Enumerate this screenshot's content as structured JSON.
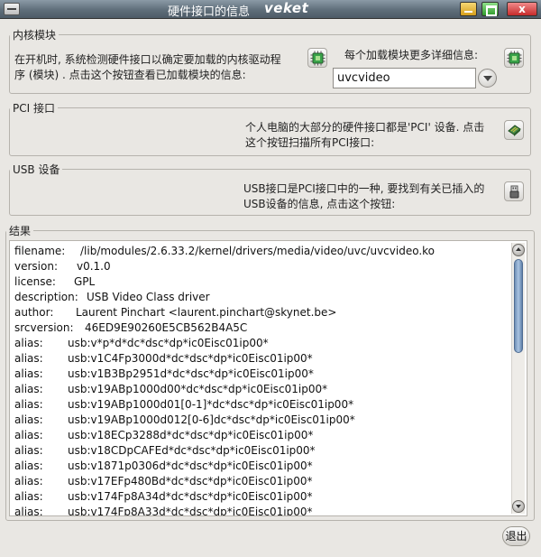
{
  "window": {
    "title": "硬件接口的信息",
    "brand": "veket",
    "close_label": "x"
  },
  "kernel_modules": {
    "label": "内核模块",
    "desc_line1": "在开机时, 系统检测硬件接口以确定要加载的内核驱动程",
    "desc_line2": "序 (模块) . 点击这个按钮查看已加载模块的信息:",
    "detail_label": "每个加载模块更多详细信息:",
    "module_select_value": "uvcvideo"
  },
  "pci": {
    "label": "PCI 接口",
    "desc_line1": "个人电脑的大部分的硬件接口都是'PCI' 设备. 点击",
    "desc_line2": "这个按钮扫描所有PCI接口:"
  },
  "usb": {
    "label": "USB 设备",
    "desc_line1": "USB接口是PCI接口中的一种, 要找到有关已插入的",
    "desc_line2": "USB设备的信息, 点击这个按钮:"
  },
  "results": {
    "label": "结果",
    "lines": [
      {
        "key": "filename:",
        "value": "/lib/modules/2.6.33.2/kernel/drivers/media/video/uvc/uvcvideo.ko"
      },
      {
        "key": "version:",
        "value": "v0.1.0"
      },
      {
        "key": "license:",
        "value": "GPL"
      },
      {
        "key": "description:",
        "value": "USB Video Class driver"
      },
      {
        "key": "author:",
        "value": "Laurent Pinchart <laurent.pinchart@skynet.be>"
      },
      {
        "key": "srcversion:",
        "value": "46ED9E90260E5CB562B4A5C"
      },
      {
        "key": "alias:",
        "value": "usb:v*p*d*dc*dsc*dp*ic0Eisc01ip00*"
      },
      {
        "key": "alias:",
        "value": "usb:v1C4Fp3000d*dc*dsc*dp*ic0Eisc01ip00*"
      },
      {
        "key": "alias:",
        "value": "usb:v1B3Bp2951d*dc*dsc*dp*ic0Eisc01ip00*"
      },
      {
        "key": "alias:",
        "value": "usb:v19ABp1000d00*dc*dsc*dp*ic0Eisc01ip00*"
      },
      {
        "key": "alias:",
        "value": "usb:v19ABp1000d01[0-1]*dc*dsc*dp*ic0Eisc01ip00*"
      },
      {
        "key": "alias:",
        "value": "usb:v19ABp1000d012[0-6]dc*dsc*dp*ic0Eisc01ip00*"
      },
      {
        "key": "alias:",
        "value": "usb:v18ECp3288d*dc*dsc*dp*ic0Eisc01ip00*"
      },
      {
        "key": "alias:",
        "value": "usb:v18CDpCAFEd*dc*dsc*dp*ic0Eisc01ip00*"
      },
      {
        "key": "alias:",
        "value": "usb:v1871p0306d*dc*dsc*dp*ic0Eisc01ip00*"
      },
      {
        "key": "alias:",
        "value": "usb:v17EFp480Bd*dc*dsc*dp*ic0Eisc01ip00*"
      },
      {
        "key": "alias:",
        "value": "usb:v174Fp8A34d*dc*dsc*dp*ic0Eisc01ip00*"
      },
      {
        "key": "alias:",
        "value": "usb:v174Fp8A33d*dc*dsc*dp*ic0Eisc01ip00*"
      }
    ]
  },
  "footer": {
    "exit_label": "退出"
  },
  "icons": {
    "modules_button": "chip-icon",
    "module_details_button": "chip-icon",
    "pci_button": "card-icon",
    "usb_button": "usb-plug-icon",
    "combo": "chevron-down-icon"
  },
  "colors": {
    "titlebar": "#5f6e7a",
    "chip_green": "#3aa34a",
    "scroll_thumb": "#7f9fc6"
  }
}
